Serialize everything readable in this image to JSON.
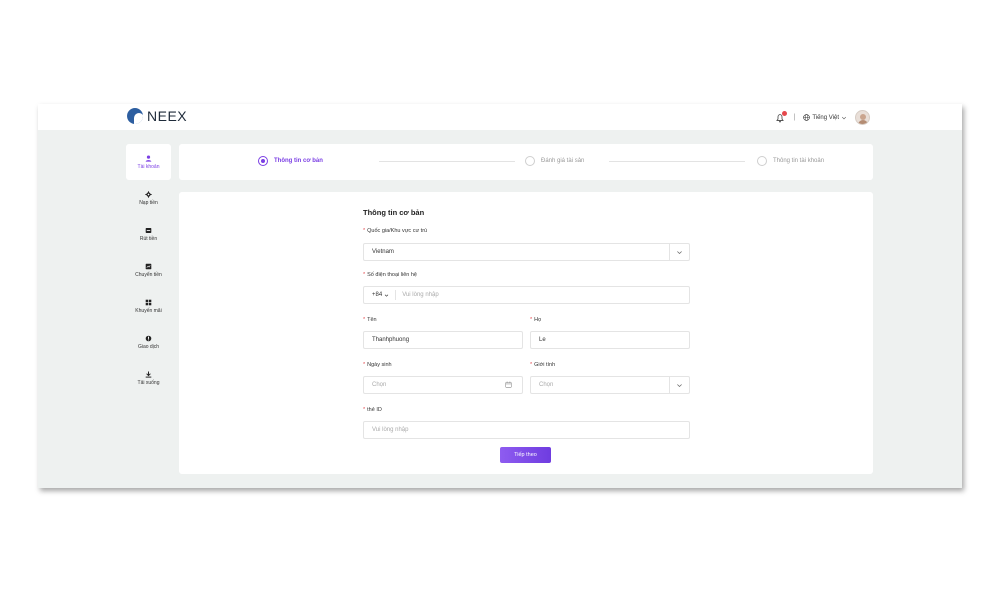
{
  "app": {
    "brand": "NEEX"
  },
  "topbar": {
    "separator": "|",
    "language": "Tiếng Việt"
  },
  "sidebar": {
    "items": [
      {
        "label": "Tài khoản",
        "icon": "user-icon",
        "active": true
      },
      {
        "label": "Nạp tiền",
        "icon": "deposit-icon"
      },
      {
        "label": "Rút tiền",
        "icon": "withdraw-icon"
      },
      {
        "label": "Chuyển tiền",
        "icon": "transfer-icon"
      },
      {
        "label": "Khuyến mãi",
        "icon": "promotion-icon"
      },
      {
        "label": "Giao dịch",
        "icon": "trade-icon"
      },
      {
        "label": "Tải xuống",
        "icon": "download-icon"
      }
    ]
  },
  "steps": [
    {
      "label": "Thông tin cơ bản",
      "active": true
    },
    {
      "label": "Đánh giá tài sản",
      "active": false
    },
    {
      "label": "Thông tin tài khoản",
      "active": false
    }
  ],
  "form": {
    "title": "Thông tin cơ bản",
    "required_mark": "*",
    "country": {
      "label": "Quốc gia/Khu vực cư trú",
      "value": "Vietnam"
    },
    "phone": {
      "label": "Số điện thoại liên hệ",
      "prefix": "+84",
      "placeholder": "Vui lòng nhập"
    },
    "first_name": {
      "label": "Tên",
      "value": "Thanhphuong"
    },
    "last_name": {
      "label": "Họ",
      "value": "Le"
    },
    "birthday": {
      "label": "Ngày sinh",
      "placeholder": "Chọn"
    },
    "gender": {
      "label": "Giới tính",
      "placeholder": "Chọn"
    },
    "id_card": {
      "label": "thẻ ID",
      "placeholder": "Vui lòng nhập"
    },
    "next_button": "Tiếp theo"
  },
  "colors": {
    "accent": "#7b3fe4",
    "required": "#e5484d",
    "background": "#eef1f0"
  }
}
